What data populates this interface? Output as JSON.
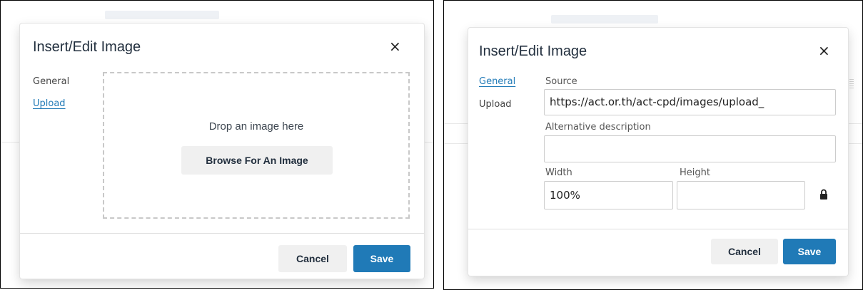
{
  "left": {
    "dialog": {
      "title": "Insert/Edit Image",
      "close_icon": "×",
      "tabs": [
        {
          "label": "General",
          "active": false
        },
        {
          "label": "Upload",
          "active": true
        }
      ],
      "dropzone_text": "Drop an image here",
      "browse_label": "Browse For An Image",
      "cancel_label": "Cancel",
      "save_label": "Save"
    }
  },
  "right": {
    "dialog": {
      "title": "Insert/Edit Image",
      "close_icon": "×",
      "tabs": [
        {
          "label": "General",
          "active": true
        },
        {
          "label": "Upload",
          "active": false
        }
      ],
      "source_label": "Source",
      "source_value": "https://act.or.th/act-cpd/images/upload_",
      "alt_label": "Alternative description",
      "alt_value": "",
      "width_label": "Width",
      "width_value": "100%",
      "height_label": "Height",
      "height_value": "",
      "cancel_label": "Cancel",
      "save_label": "Save"
    }
  },
  "colors": {
    "accent": "#207ab7",
    "text": "#222f3e",
    "secondary_button": "#f0f0f0"
  },
  "icons": [
    "close-icon",
    "lock-icon"
  ]
}
